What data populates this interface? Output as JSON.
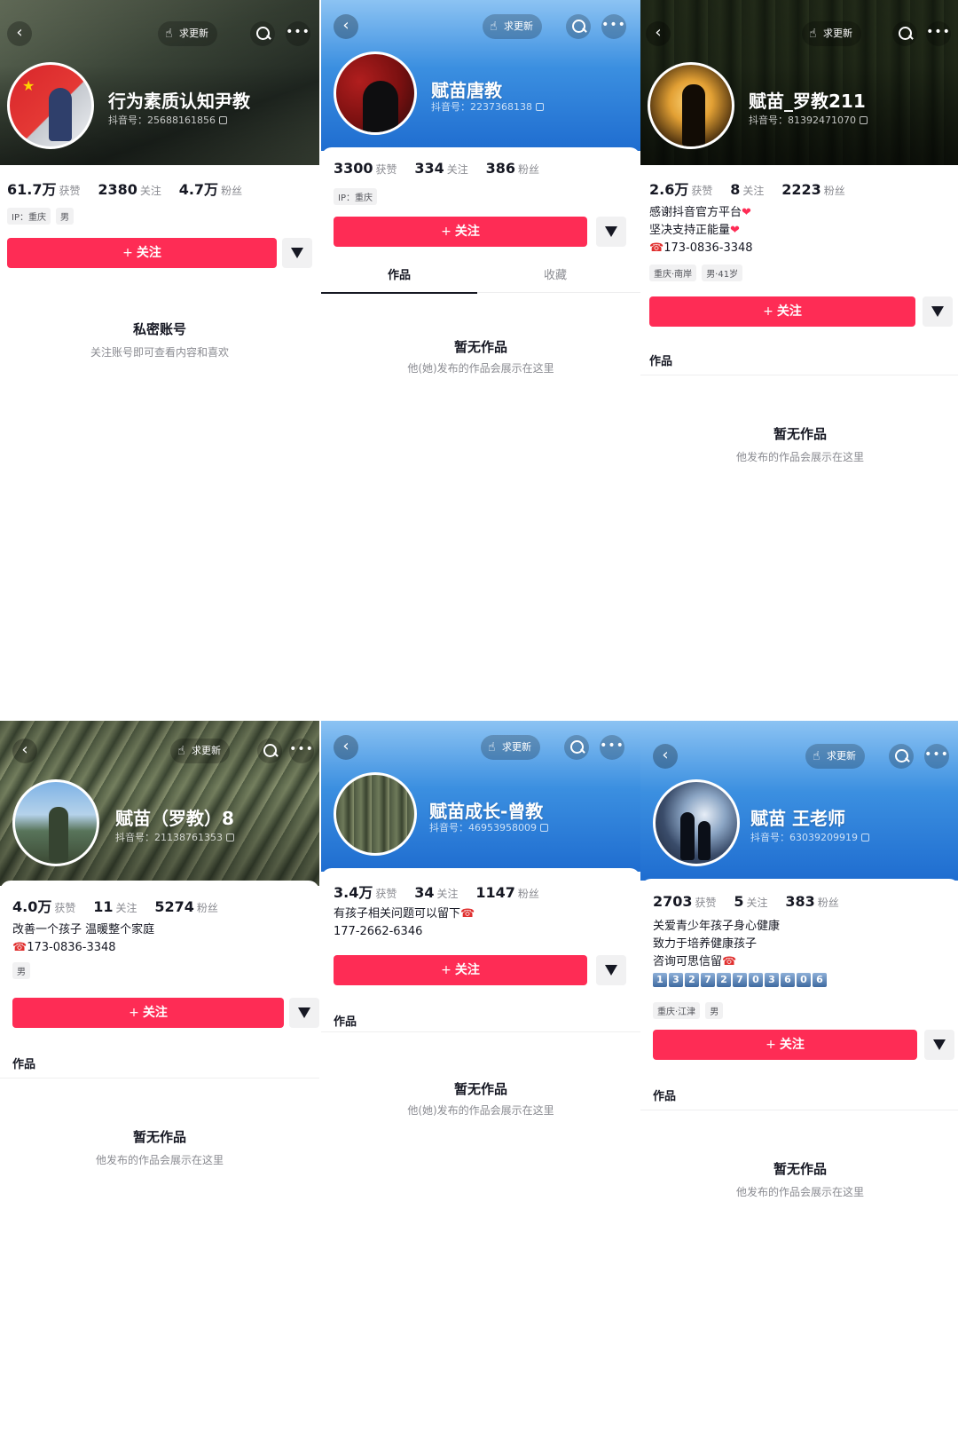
{
  "common": {
    "refresh_label": "求更新",
    "follow_label": "关注",
    "follow_plus": "+",
    "likes_label": "获赞",
    "following_label": "关注",
    "fans_label": "粉丝",
    "works_label": "作品",
    "uid_prefix": "抖音号：",
    "empty_title": "暂无作品"
  },
  "profiles": [
    {
      "nickname": "行为素质认知尹教",
      "uid": "25688161856",
      "likes": "61.7万",
      "following": "2380",
      "fans": "4.7万",
      "tags": [
        "IP：重庆",
        "男"
      ],
      "private_title": "私密账号",
      "private_sub": "关注账号即可查看内容和喜欢"
    },
    {
      "nickname": "赋苗唐教",
      "uid": "2237368138",
      "likes": "3300",
      "following": "334",
      "fans": "386",
      "tags": [
        "IP：重庆"
      ],
      "tabs": [
        "作品",
        "收藏"
      ],
      "empty_sub": "他(她)发布的作品会展示在这里"
    },
    {
      "nickname": "赋苗_罗教211",
      "uid": "81392471070",
      "likes": "2.6万",
      "following": "8",
      "fans": "2223",
      "bio": [
        "感谢抖音官方平台",
        "坚决支持正能量",
        "173-0836-3348"
      ],
      "tags": [
        "重庆·南岸",
        "男·41岁"
      ],
      "empty_sub": "他发布的作品会展示在这里"
    },
    {
      "nickname": "赋苗（罗教）8",
      "uid": "21138761353",
      "likes": "4.0万",
      "following": "11",
      "fans": "5274",
      "bio": [
        "改善一个孩子  温暖整个家庭",
        "173-0836-3348"
      ],
      "tags": [
        "男"
      ],
      "empty_sub": "他发布的作品会展示在这里"
    },
    {
      "nickname": "赋苗成长-曾教",
      "uid": "46953958009",
      "likes": "3.4万",
      "following": "34",
      "fans": "1147",
      "bio": [
        "有孩子相关问题可以留下",
        "177-2662-6346"
      ],
      "empty_sub": "他(她)发布的作品会展示在这里"
    },
    {
      "nickname": "赋苗 王老师",
      "uid": "63039209919",
      "likes": "2703",
      "following": "5",
      "fans": "383",
      "bio": [
        "关爱青少年孩子身心健康",
        "致力于培养健康孩子",
        "咨询可思信留"
      ],
      "digits": [
        "1",
        "3",
        "2",
        "7",
        "2",
        "7",
        "0",
        "3",
        "6",
        "0",
        "6"
      ],
      "tags": [
        "重庆·江津",
        "男"
      ],
      "empty_sub": "他发布的作品会展示在这里"
    }
  ],
  "icons": [
    "back-icon",
    "thumb-up-icon",
    "search-icon",
    "more-icon",
    "share-icon",
    "copy-icon",
    "heart-icon",
    "phone-icon"
  ],
  "colors": {
    "accent": "#fe2c55",
    "blue_cover": "#3b8fe0"
  }
}
